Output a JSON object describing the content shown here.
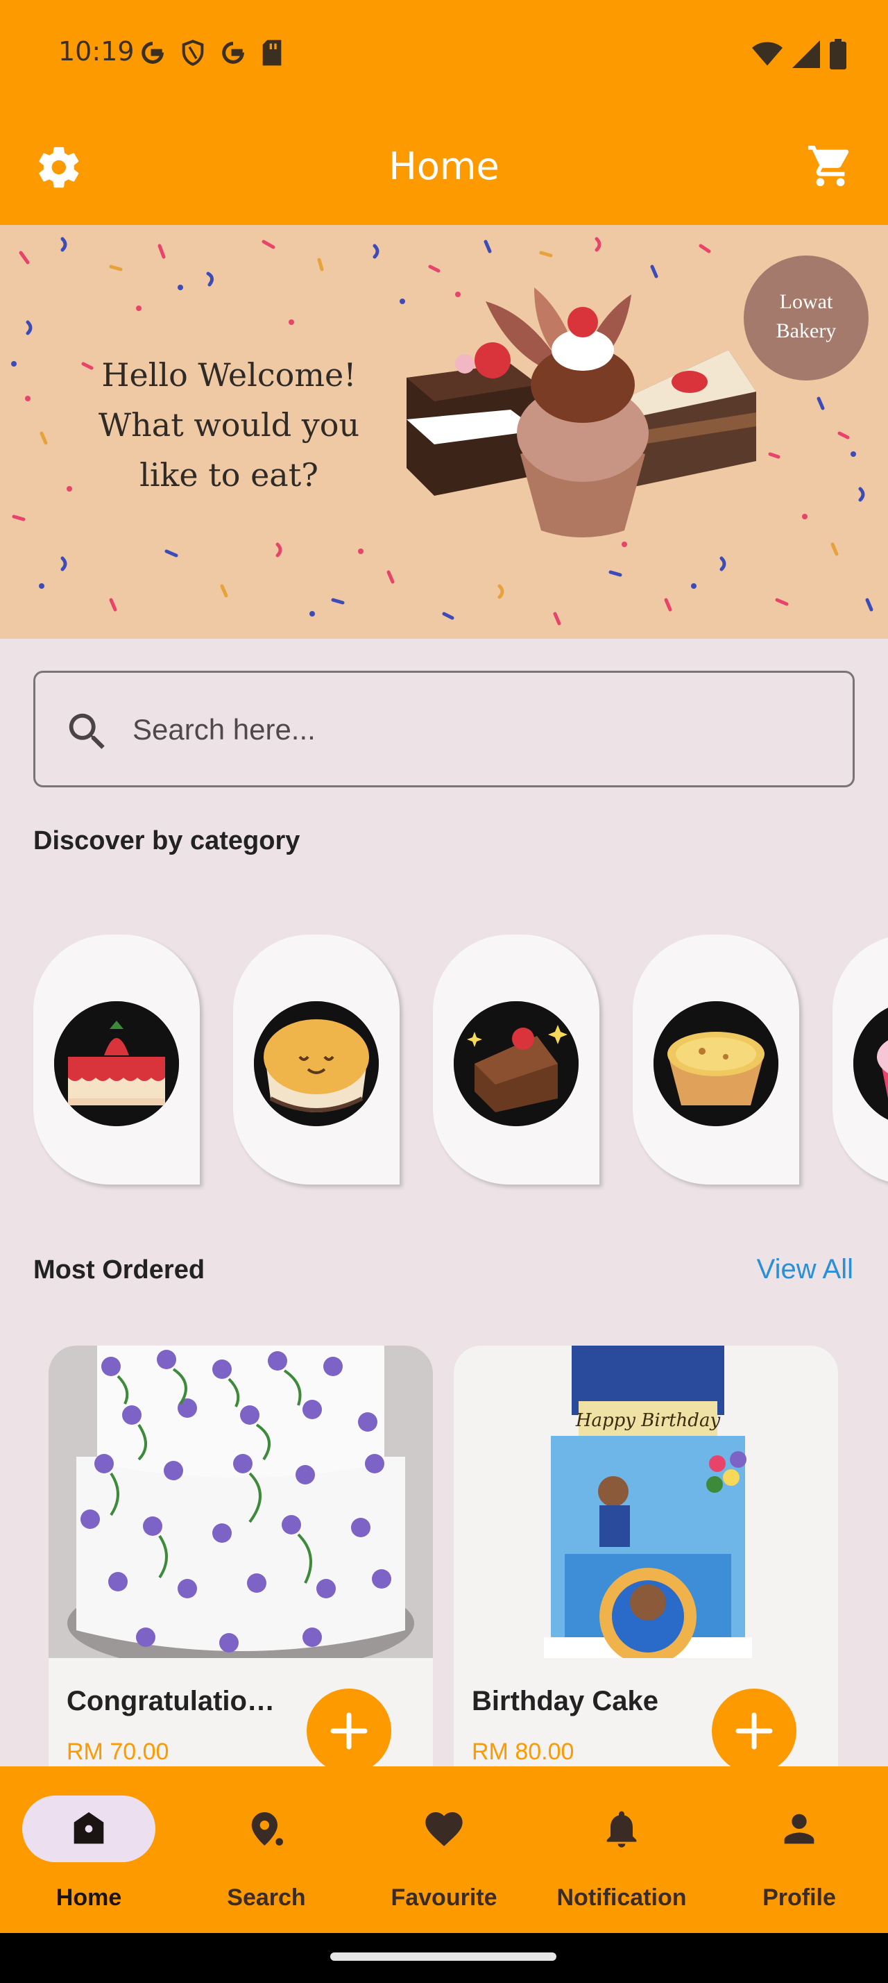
{
  "status_bar": {
    "time": "10:19",
    "left_icons": [
      "google-icon",
      "shield-icon",
      "google-icon",
      "sd-card-icon"
    ],
    "right_icons": [
      "wifi-icon",
      "signal-icon",
      "battery-icon"
    ]
  },
  "app_bar": {
    "title": "Home",
    "left_icon": "gear-icon",
    "right_icon": "cart-icon"
  },
  "banner": {
    "line1": "Hello Welcome!",
    "line2": "What would you",
    "line3": "like to eat?",
    "badge_line1": "Lowat",
    "badge_line2": "Bakery"
  },
  "search": {
    "placeholder": "Search here...",
    "value": ""
  },
  "categories": {
    "title": "Discover by category",
    "items": [
      "strawberry-cake-icon",
      "pudding-icon",
      "brownie-icon",
      "egg-tart-icon",
      "cupcake-icon"
    ]
  },
  "most_ordered": {
    "title": "Most Ordered",
    "view_all": "View All",
    "products": [
      {
        "name": "Congratulatio…",
        "price": "RM 70.00"
      },
      {
        "name": "Birthday Cake",
        "price": "RM 80.00"
      }
    ]
  },
  "bottom_nav": {
    "items": [
      {
        "label": "Home",
        "icon": "home-icon",
        "active": true
      },
      {
        "label": "Search",
        "icon": "search-icon",
        "active": false
      },
      {
        "label": "Favourite",
        "icon": "heart-icon",
        "active": false
      },
      {
        "label": "Notification",
        "icon": "bell-icon",
        "active": false
      },
      {
        "label": "Profile",
        "icon": "person-icon",
        "active": false
      }
    ]
  },
  "colors": {
    "accent": "#fd9a00",
    "background": "#ede3e7",
    "link": "#2a8fd6"
  }
}
